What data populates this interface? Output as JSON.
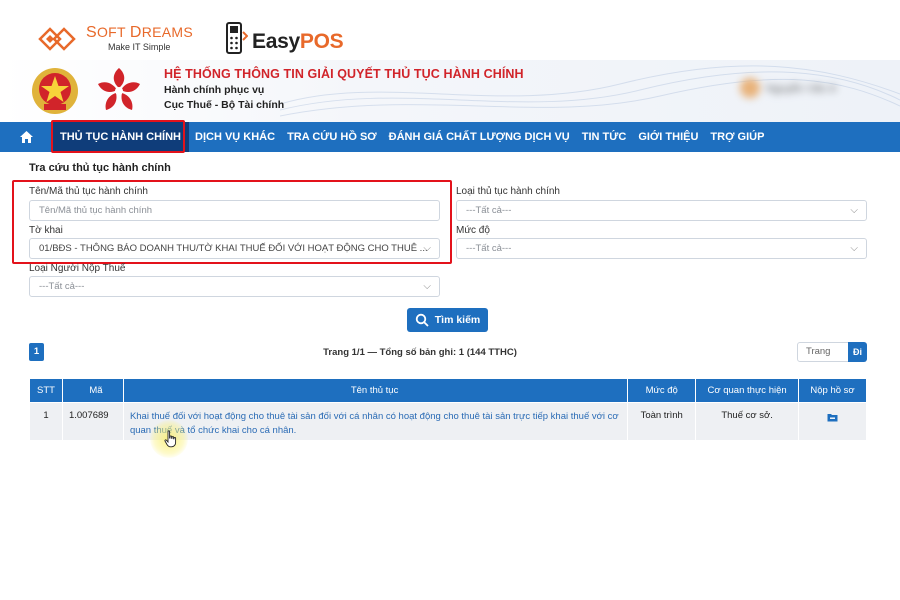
{
  "brand": {
    "softdreams_name_1": "S",
    "softdreams_name_2": "OFT ",
    "softdreams_name_3": "D",
    "softdreams_name_4": "REAMS",
    "softdreams_tagline": "Make IT Simple",
    "easypos_part1": "Easy",
    "easypos_part2": "POS"
  },
  "header": {
    "system_title": "HỆ THỐNG THÔNG TIN GIẢI QUYẾT THỦ TỤC HÀNH CHÍNH",
    "subtitle_1": "Hành chính phục vụ",
    "subtitle_2": "Cục Thuế - Bộ Tài chính",
    "user_name": "Nguyễn Văn A"
  },
  "nav": {
    "items": [
      "THỦ TỤC HÀNH CHÍNH",
      "DỊCH VỤ KHÁC",
      "TRA CỨU HỒ SƠ",
      "ĐÁNH GIÁ CHẤT LƯỢNG DỊCH VỤ",
      "TIN TỨC",
      "GIỚI THIỆU",
      "TRỢ GIÚP"
    ],
    "active_index": 0
  },
  "search": {
    "section_title": "Tra cứu thủ tục hành chính",
    "name_label": "Tên/Mã thủ tục hành chính",
    "name_placeholder": "Tên/Mã thủ tục hành chính",
    "type_label": "Loại thủ tục hành chính",
    "type_value": "---Tất cả---",
    "form_label": "Tờ khai",
    "form_value": "01/BĐS - THÔNG BÁO DOANH THU/TỜ KHAI THUẾ ĐỐI VỚI HOẠT ĐỘNG CHO THUÊ ...",
    "level_label": "Mức độ",
    "level_value": "---Tất cả---",
    "taxpayer_label": "Loại Người Nộp Thuế",
    "taxpayer_value": "---Tất cả---",
    "search_button": "Tìm kiếm"
  },
  "pager": {
    "current_page": "1",
    "summary": "Trang 1/1 — Tổng số bản ghi: 1 (144 TTHC)",
    "page_placeholder": "Trang",
    "go_label": "Đi"
  },
  "table": {
    "headers": [
      "STT",
      "Mã",
      "Tên thủ tục",
      "Mức độ",
      "Cơ quan thực hiện",
      "Nộp hồ sơ"
    ],
    "rows": [
      {
        "stt": "1",
        "code": "1.007689",
        "name": "Khai thuế đối với hoạt động cho thuê tài sản đối với cá nhân có hoạt động cho thuê tài sản trực tiếp khai thuế với cơ quan thuế và tổ chức khai cho cá nhân.",
        "level": "Toàn trình",
        "agency": "Thuế cơ sở."
      }
    ]
  },
  "colors": {
    "nav_blue": "#1e6fbf",
    "nav_active": "#0f3d7a",
    "highlight_red": "#e3121b",
    "title_red": "#d1242a",
    "brand_orange": "#e8692a",
    "link_blue": "#2a6bb5"
  },
  "icons": {
    "home": "home-icon",
    "search": "search-icon",
    "chevron": "chevron-down-icon",
    "submit": "submit-file-icon",
    "pointer": "hand-pointer-icon"
  }
}
